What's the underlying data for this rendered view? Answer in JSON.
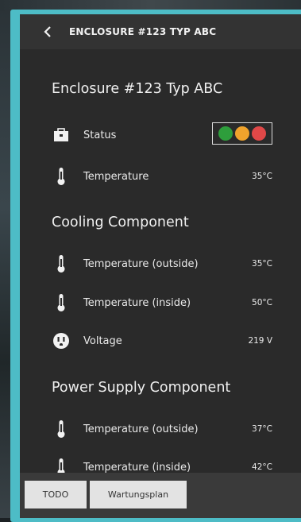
{
  "header": {
    "title": "ENCLOSURE #123 TYP ABC"
  },
  "enclosure": {
    "title": "Enclosure #123 Typ ABC",
    "status_label": "Status",
    "status_lights": [
      "#2e9e3c",
      "#f0a32c",
      "#e04848"
    ],
    "temperature_label": "Temperature",
    "temperature_value": "35°C"
  },
  "cooling": {
    "title": "Cooling Component",
    "temp_outside_label": "Temperature (outside)",
    "temp_outside_value": "35°C",
    "temp_inside_label": "Temperature (inside)",
    "temp_inside_value": "50°C",
    "voltage_label": "Voltage",
    "voltage_value": "219 V"
  },
  "power": {
    "title": "Power Supply Component",
    "temp_outside_label": "Temperature (outside)",
    "temp_outside_value": "37°C",
    "temp_inside_label": "Temperature (inside)",
    "temp_inside_value": "42°C"
  },
  "footer": {
    "todo_label": "TODO",
    "wartungsplan_label": "Wartungsplan"
  }
}
